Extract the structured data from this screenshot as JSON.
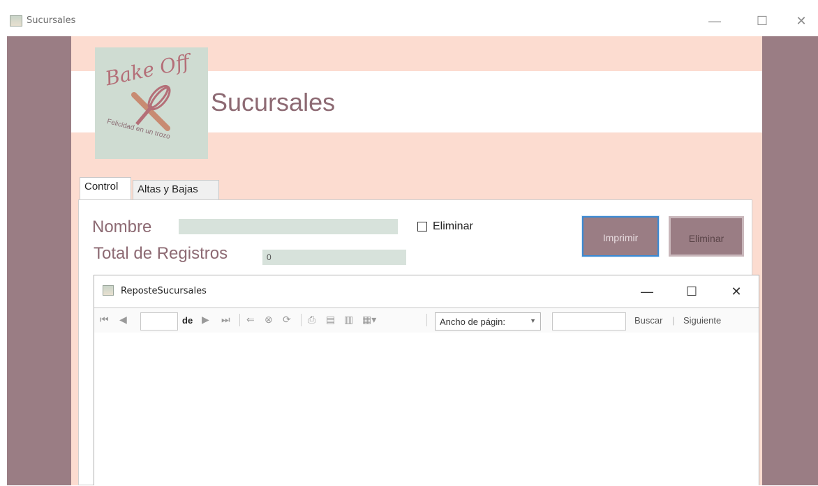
{
  "window": {
    "title": "Sucursales",
    "min": "—",
    "max": "☐",
    "close": "✕"
  },
  "logo": {
    "brand": "Bake Off",
    "tagline": "Felicidad en un trozo"
  },
  "header": {
    "title": "Sucursales"
  },
  "tabs": [
    {
      "label": "Control"
    },
    {
      "label": "Altas y Bajas"
    }
  ],
  "form": {
    "nombre_label": "Nombre",
    "nombre_value": "",
    "total_label": "Total de Registros",
    "total_value": "0",
    "eliminar_checkbox_label": "Eliminar"
  },
  "buttons": {
    "imprimir": "Imprimir",
    "eliminar": "Eliminar"
  },
  "report": {
    "title": "ReposteSucursales",
    "min": "—",
    "max": "☐",
    "close": "✕",
    "page_input": "",
    "of_label": "de",
    "zoom_value": "Ancho de págin:",
    "search_input": "",
    "buscar": "Buscar",
    "separator": "|",
    "siguiente": "Siguiente"
  },
  "colors": {
    "mauve": "#9a7d84",
    "peach": "#fcdcd0",
    "sage": "#d7e2db",
    "title_text": "#8d6a73"
  }
}
